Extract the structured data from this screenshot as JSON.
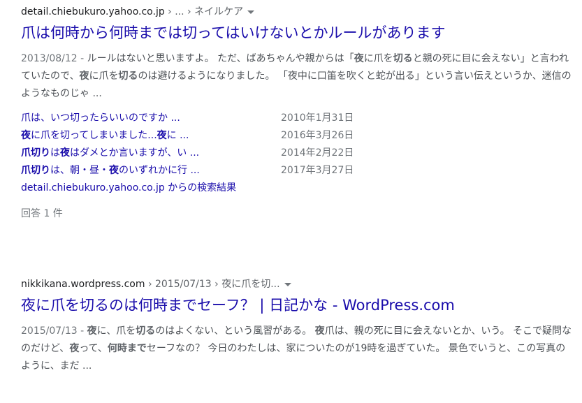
{
  "result1": {
    "breadcrumb": {
      "domain": "detail.chiebukuro.yahoo.co.jp",
      "sep": " › ... › ",
      "path": "ネイルケア"
    },
    "title": "爪は何時から何時までは切ってはいけないとかルールがあります",
    "snippet": {
      "date": "2013/08/12 - ",
      "t1": "ルールはないと思いますよ。 ただ、ばあちゃんや親からは「",
      "b1": "夜",
      "t2": "に爪を",
      "b2": "切る",
      "t3": "と親の死に目に会えない」と言われていたので、",
      "b3": "夜",
      "t4": "に爪を",
      "b4": "切る",
      "t5": "のは避けるようになりました。 「夜中に口笛を吹くと蛇が出る」という言い伝えというか、迷信のようなものじゃ ..."
    },
    "sub_results": [
      {
        "parts": [
          {
            "b": false,
            "t": "爪は、いつ切ったらいいのですか ..."
          }
        ],
        "date": "2010年1月31日"
      },
      {
        "parts": [
          {
            "b": true,
            "t": "夜"
          },
          {
            "b": false,
            "t": "に爪を切ってしまいました..."
          },
          {
            "b": true,
            "t": "夜"
          },
          {
            "b": false,
            "t": "に ..."
          }
        ],
        "date": "2016年3月26日"
      },
      {
        "parts": [
          {
            "b": true,
            "t": "爪切り"
          },
          {
            "b": false,
            "t": "は"
          },
          {
            "b": true,
            "t": "夜"
          },
          {
            "b": false,
            "t": "はダメとか言いますが、い ..."
          }
        ],
        "date": "2014年2月22日"
      },
      {
        "parts": [
          {
            "b": true,
            "t": "爪切り"
          },
          {
            "b": false,
            "t": "は、朝・昼・"
          },
          {
            "b": true,
            "t": "夜"
          },
          {
            "b": false,
            "t": "のいずれかに行 ..."
          }
        ],
        "date": "2017年3月27日"
      }
    ],
    "more_link": "detail.chiebukuro.yahoo.co.jp からの検索結果",
    "answers": "回答 1 件"
  },
  "result2": {
    "breadcrumb": {
      "domain": "nikkikana.wordpress.com",
      "sep": " › ",
      "path": "2015/07/13 › 夜に爪を切..."
    },
    "title": "夜に爪を切るのは何時までセーフ？ | 日記かな - WordPress.com",
    "snippet": {
      "date": "2015/07/13 - ",
      "b1": "夜",
      "t1": "に、爪を",
      "b2": "切る",
      "t2": "のはよくない、という風習がある。 ",
      "b3": "夜",
      "t3": "爪は、親の死に目に会えないとか、いう。 そこで疑問なのだけど、",
      "b4": "夜",
      "t4": "って、",
      "b5": "何時まで",
      "t5": "セーフなの？ 今日のわたしは、家についたのが19時を過ぎていた。 景色でいうと、この写真のように、まだ ..."
    }
  },
  "colors": {
    "link": "#1a0dab",
    "text": "#4d5156",
    "meta": "#70757a",
    "bold": "#5f6368"
  }
}
